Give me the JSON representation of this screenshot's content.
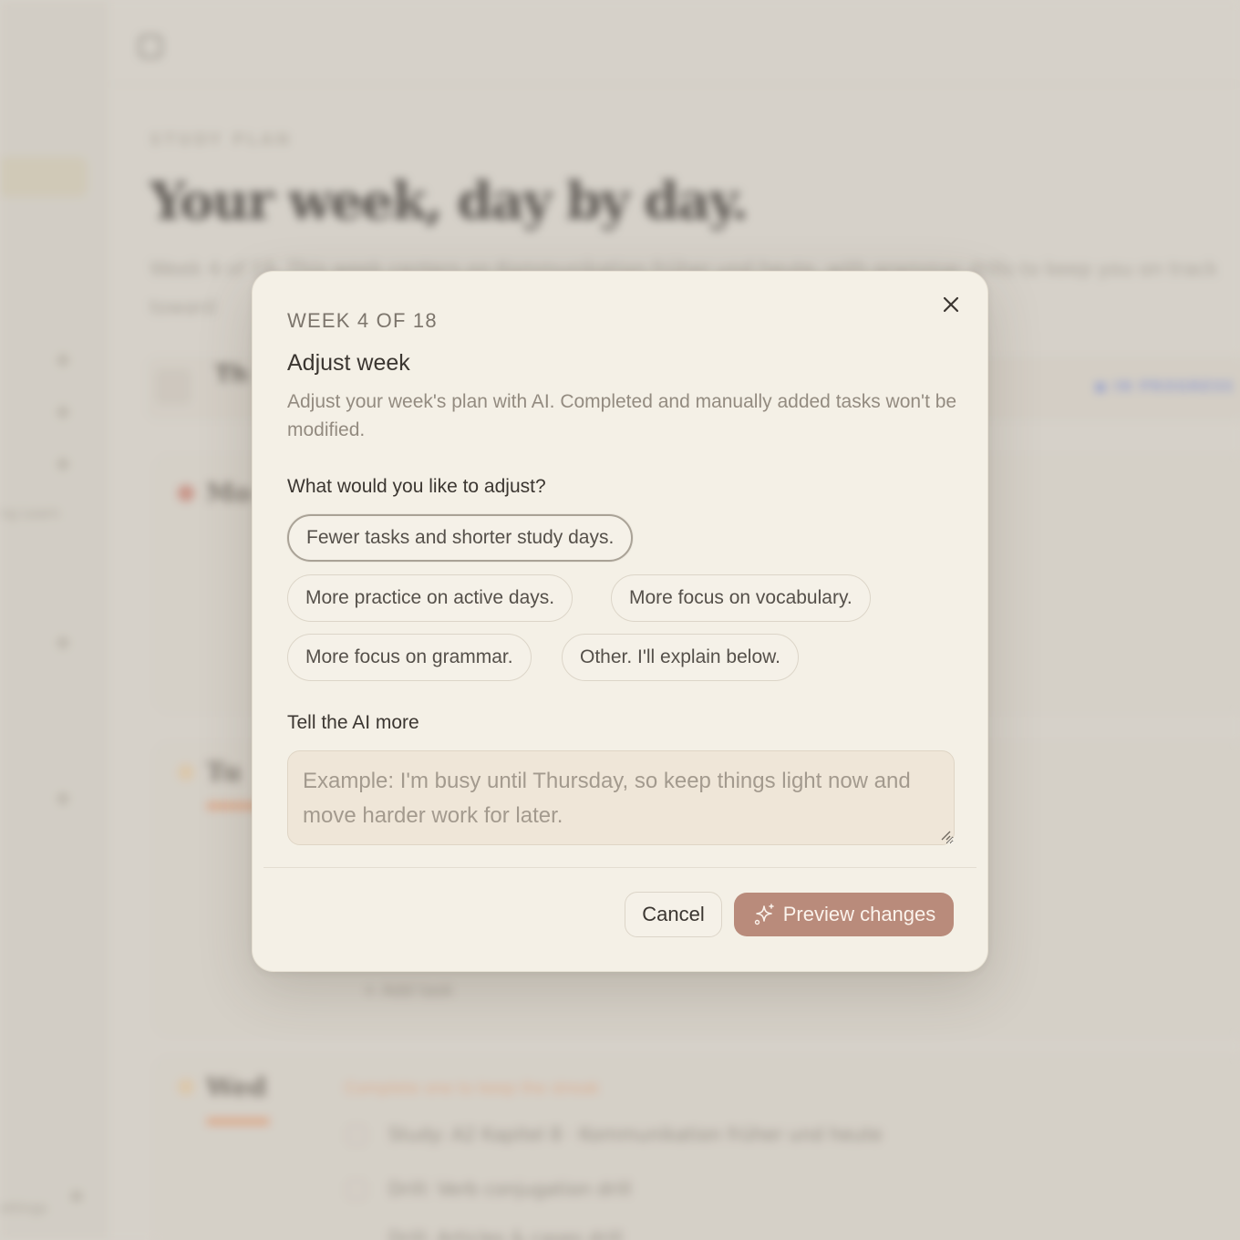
{
  "background": {
    "eyebrow": "STUDY PLAN",
    "title": "Your week, day by day.",
    "subtitle": "Week 4 of 18. This week centers on Kommunikation früher und heute, with grammar drills to keep you on track toward",
    "week_name": "Th",
    "status": "● IN PROGRESS",
    "day_labels": [
      "Mo",
      "Tu",
      "Wed"
    ],
    "orange_note": "Complete one to keep the streak",
    "tasks": [
      "Study: A2 Kapitel 8 · Kommunikation früher und heute",
      "Drill: Verb conjugation drill",
      "Drill: Articles & cases drill"
    ],
    "add_task": "+ Add task",
    "side_texts": [
      "ng Learn",
      "ettings"
    ]
  },
  "dialog": {
    "eyebrow": "Week 4 of 18",
    "title": "Adjust week",
    "description": "Adjust your week's plan with AI. Completed and manually added tasks won't be modified.",
    "question": "What would you like to adjust?",
    "options": [
      "Fewer tasks and shorter study days.",
      "More practice on active days.",
      "More focus on vocabulary.",
      "More focus on grammar.",
      "Other. I'll explain below."
    ],
    "selected_option": "Fewer tasks and shorter study days.",
    "more_label": "Tell the AI more",
    "textarea_placeholder": "Example: I'm busy until Thursday, so keep things light now and move harder work for later.",
    "cancel_label": "Cancel",
    "preview_label": "Preview changes"
  },
  "colors": {
    "dialog_bg": "#f4f0e6",
    "accent": "#b98b7b",
    "textarea_bg": "#efe6d8"
  }
}
